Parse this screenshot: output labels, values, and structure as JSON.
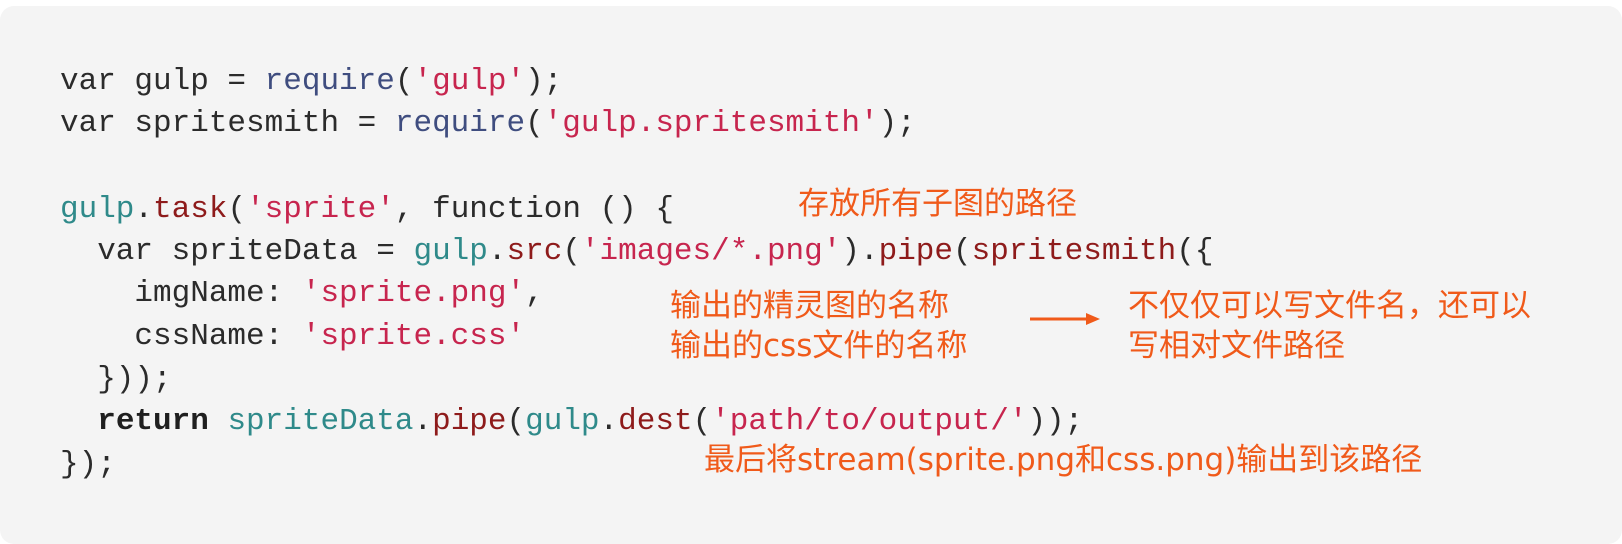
{
  "code": {
    "lines": [
      [
        {
          "t": "var gulp = ",
          "c": "plain"
        },
        {
          "t": "require",
          "c": "fn"
        },
        {
          "t": "(",
          "c": "plain"
        },
        {
          "t": "'gulp'",
          "c": "str"
        },
        {
          "t": ");",
          "c": "plain"
        }
      ],
      [
        {
          "t": "var spritesmith = ",
          "c": "plain"
        },
        {
          "t": "require",
          "c": "fn"
        },
        {
          "t": "(",
          "c": "plain"
        },
        {
          "t": "'gulp.spritesmith'",
          "c": "str"
        },
        {
          "t": ");",
          "c": "plain"
        }
      ],
      [],
      [
        {
          "t": "gulp",
          "c": "obj"
        },
        {
          "t": ".",
          "c": "plain"
        },
        {
          "t": "task",
          "c": "method"
        },
        {
          "t": "(",
          "c": "plain"
        },
        {
          "t": "'sprite'",
          "c": "str"
        },
        {
          "t": ", function () {",
          "c": "plain"
        }
      ],
      [
        {
          "t": "  var spriteData = ",
          "c": "plain"
        },
        {
          "t": "gulp",
          "c": "obj"
        },
        {
          "t": ".",
          "c": "plain"
        },
        {
          "t": "src",
          "c": "method"
        },
        {
          "t": "(",
          "c": "plain"
        },
        {
          "t": "'images/*.png'",
          "c": "str"
        },
        {
          "t": ").",
          "c": "plain"
        },
        {
          "t": "pipe",
          "c": "method"
        },
        {
          "t": "(",
          "c": "plain"
        },
        {
          "t": "spritesmith",
          "c": "method"
        },
        {
          "t": "({",
          "c": "plain"
        }
      ],
      [
        {
          "t": "    imgName: ",
          "c": "plain"
        },
        {
          "t": "'sprite.png'",
          "c": "str"
        },
        {
          "t": ",",
          "c": "plain"
        }
      ],
      [
        {
          "t": "    cssName: ",
          "c": "plain"
        },
        {
          "t": "'sprite.css'",
          "c": "str"
        }
      ],
      [
        {
          "t": "  }));",
          "c": "plain"
        }
      ],
      [
        {
          "t": "  ",
          "c": "plain"
        },
        {
          "t": "return",
          "c": "kw"
        },
        {
          "t": " ",
          "c": "plain"
        },
        {
          "t": "spriteData",
          "c": "obj"
        },
        {
          "t": ".",
          "c": "plain"
        },
        {
          "t": "pipe",
          "c": "method"
        },
        {
          "t": "(",
          "c": "plain"
        },
        {
          "t": "gulp",
          "c": "obj"
        },
        {
          "t": ".",
          "c": "plain"
        },
        {
          "t": "dest",
          "c": "method"
        },
        {
          "t": "(",
          "c": "plain"
        },
        {
          "t": "'path/to/output/'",
          "c": "str"
        },
        {
          "t": "));",
          "c": "plain"
        }
      ],
      [
        {
          "t": "});",
          "c": "plain"
        }
      ]
    ]
  },
  "annotations": {
    "src_path": "存放所有子图的路径",
    "img_name": "输出的精灵图的名称",
    "css_name": "输出的css文件的名称",
    "relative_path_line1": "不仅仅可以写文件名，还可以",
    "relative_path_line2": "写相对文件路径",
    "dest_path": "最后将stream(sprite.png和css.png)输出到该路径"
  },
  "colors": {
    "background": "#f4f4f4",
    "annotation": "#f05a1a",
    "string": "#c7254e",
    "function": "#3f4d7f",
    "object": "#2f8a8a",
    "method": "#8e1b1b"
  },
  "icons": {
    "annotation_arrow": "arrow-right-icon"
  }
}
